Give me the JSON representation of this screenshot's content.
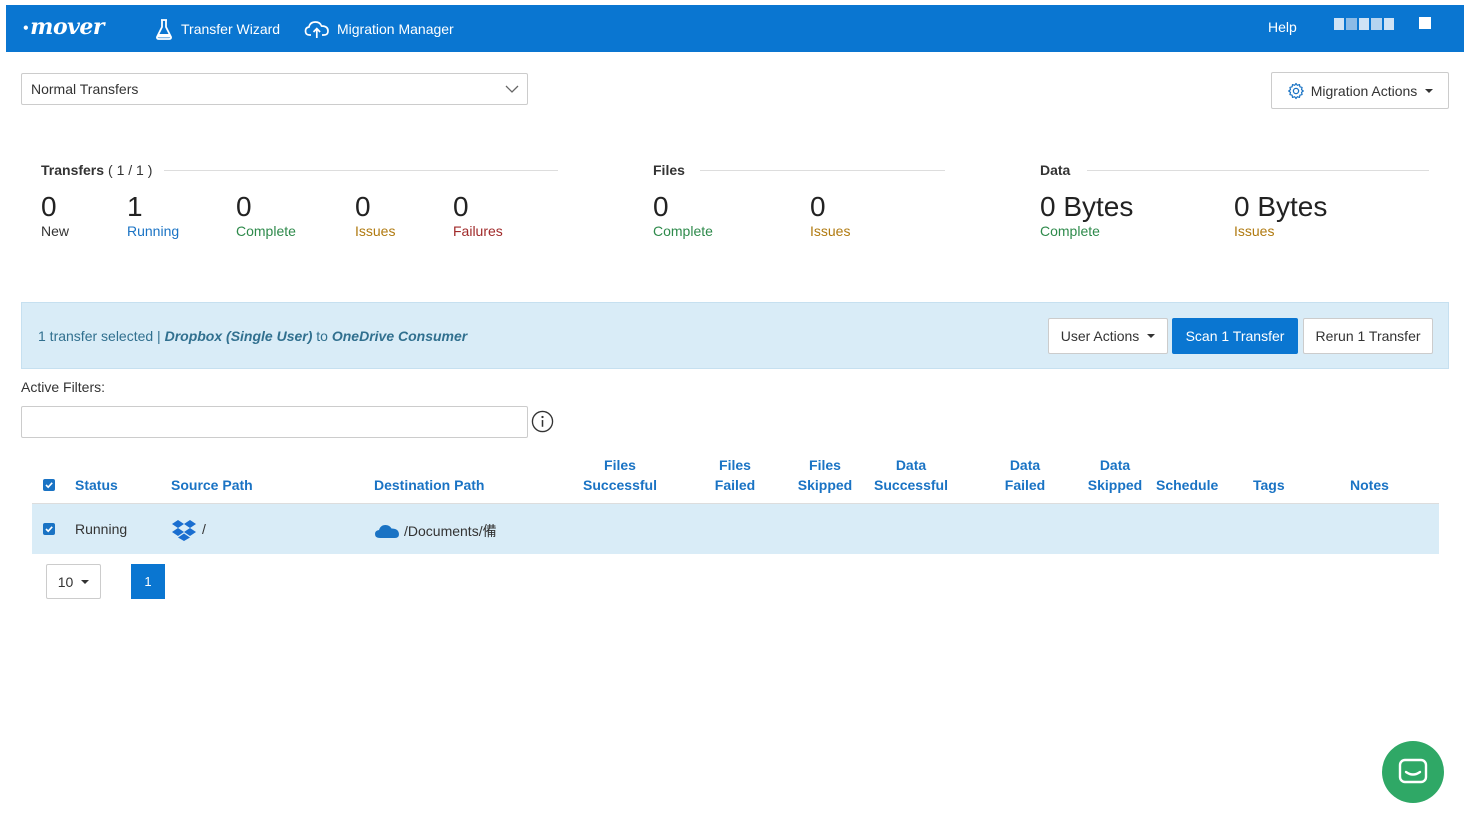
{
  "nav": {
    "logo_mark": "•",
    "logo": "mover",
    "transfer_wizard": "Transfer Wizard",
    "migration_manager": "Migration Manager",
    "help": "Help"
  },
  "transfer_type": {
    "selected": "Normal Transfers"
  },
  "migration_actions": "Migration Actions",
  "stats": {
    "transfers": {
      "title": "Transfers",
      "count": "( 1 / 1 )",
      "new": {
        "value": "0",
        "label": "New"
      },
      "running": {
        "value": "1",
        "label": "Running"
      },
      "complete": {
        "value": "0",
        "label": "Complete"
      },
      "issues": {
        "value": "0",
        "label": "Issues"
      },
      "failures": {
        "value": "0",
        "label": "Failures"
      }
    },
    "files": {
      "title": "Files",
      "complete": {
        "value": "0",
        "label": "Complete"
      },
      "issues": {
        "value": "0",
        "label": "Issues"
      }
    },
    "data": {
      "title": "Data",
      "complete": {
        "value": "0 Bytes",
        "label": "Complete"
      },
      "issues": {
        "value": "0 Bytes",
        "label": "Issues"
      }
    }
  },
  "selection": {
    "prefix": "1 transfer selected | ",
    "source": "Dropbox (Single User)",
    "middle": " to ",
    "destination": "OneDrive Consumer",
    "user_actions": "User Actions",
    "scan": "Scan 1 Transfer",
    "rerun": "Rerun 1 Transfer"
  },
  "filters": {
    "label": "Active Filters:",
    "value": ""
  },
  "table": {
    "headers": {
      "status": "Status",
      "source_path": "Source Path",
      "destination_path": "Destination Path",
      "files_successful_1": "Files",
      "files_successful_2": "Successful",
      "files_failed_1": "Files",
      "files_failed_2": "Failed",
      "files_skipped_1": "Files",
      "files_skipped_2": "Skipped",
      "data_successful_1": "Data",
      "data_successful_2": "Successful",
      "data_failed_1": "Data",
      "data_failed_2": "Failed",
      "data_skipped_1": "Data",
      "data_skipped_2": "Skipped",
      "schedule": "Schedule",
      "tags": "Tags",
      "notes": "Notes"
    },
    "rows": [
      {
        "status": "Running",
        "source_path": "/",
        "destination_path": "/Documents/備",
        "selected": true
      }
    ]
  },
  "pagination": {
    "page_size": "10",
    "current_page": "1"
  },
  "colors": {
    "brand": "#0a76d1",
    "selection_bg": "#d9ecf7",
    "chat": "#2fa866"
  }
}
